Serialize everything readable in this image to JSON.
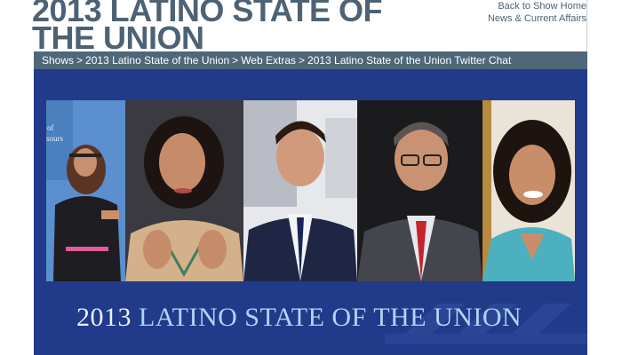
{
  "header": {
    "title_line1": "2013 LATINO STATE OF",
    "title_line2": "THE UNION",
    "links": [
      "Back to Show Home",
      "News & Current Affairs"
    ]
  },
  "breadcrumb": {
    "items": [
      "Shows",
      "Web Extras",
      "2013 Latino State of the Union",
      "2013 Latino State of the Union Twitter Chat"
    ],
    "order_display": [
      "Shows",
      "2013 Latino State of the Union",
      "Web Extras",
      "2013 Latino State of the Union Twitter Chat"
    ],
    "separator": ">"
  },
  "banner": {
    "caption_year": "2013",
    "caption_rest": "LATINO STATE OF THE UNION",
    "partial_sign_text": "of\nsours",
    "background_color": "#223a8a"
  },
  "panelists": [
    {
      "desc": "woman with glasses, dark top, pink belt"
    },
    {
      "desc": "woman with dark hair, necklace"
    },
    {
      "desc": "man in pinstripe suit"
    },
    {
      "desc": "man with glasses, red tie"
    },
    {
      "desc": "woman in turquoise jacket"
    }
  ]
}
